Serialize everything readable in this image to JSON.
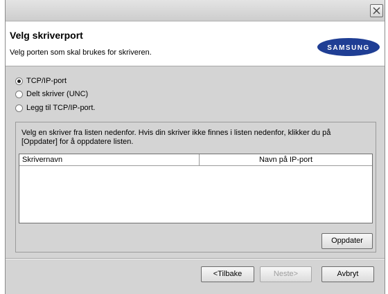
{
  "header": {
    "title": "Velg skriverport",
    "subtitle": "Velg porten som skal brukes for skriveren.",
    "logo_text": "SAMSUNG"
  },
  "options": [
    {
      "label": "TCP/IP-port",
      "selected": true
    },
    {
      "label": "Delt skriver (UNC)",
      "selected": false
    },
    {
      "label": "Legg til TCP/IP-port.",
      "selected": false
    }
  ],
  "group": {
    "instructions": "Velg en skriver fra listen nedenfor. Hvis din skriver ikke finnes i listen nedenfor, klikker du på [Oppdater] for å oppdatere listen.",
    "columns": [
      "Skrivernavn",
      "Navn på IP-port"
    ],
    "rows": [],
    "update_button": "Oppdater"
  },
  "footer": {
    "back_button": "<Tilbake",
    "next_button": "Neste>",
    "cancel_button": "Avbryt"
  },
  "colors": {
    "logo_blue": "#1f3e94",
    "selected_dot": "#222222"
  }
}
